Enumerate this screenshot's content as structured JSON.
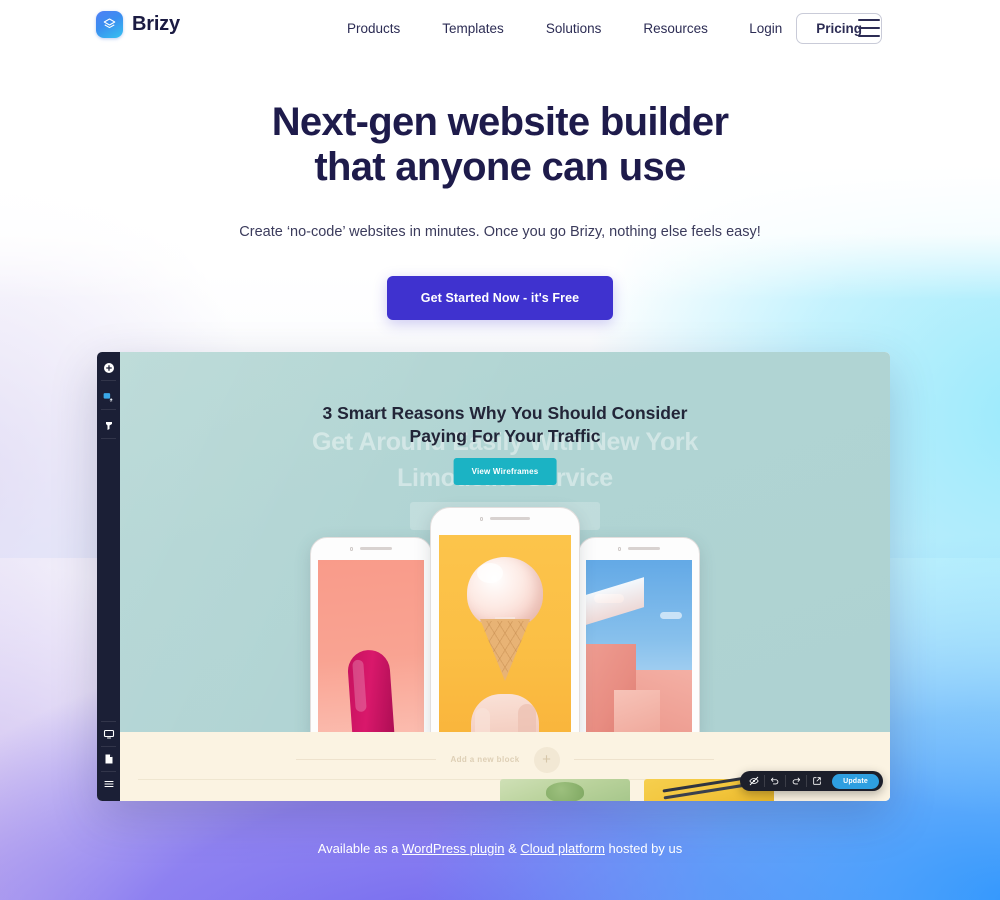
{
  "header": {
    "brand": {
      "name": "Brizy",
      "icon": "layers-icon"
    },
    "nav": [
      {
        "label": "Products"
      },
      {
        "label": "Templates"
      },
      {
        "label": "Solutions"
      },
      {
        "label": "Resources"
      }
    ],
    "login_label": "Login",
    "pricing_label": "Pricing",
    "menu_icon": "hamburger-menu-icon"
  },
  "hero": {
    "title_line1": "Next-gen website builder",
    "title_line2": "that anyone can use",
    "subtitle": "Create ‘no-code’ websites in minutes. Once you go Brizy, nothing else feels easy!",
    "cta_label": "Get Started Now - it's Free",
    "cta_color": "#3f32cf",
    "title_color": "#1e1b4b"
  },
  "editor": {
    "sidebar_tools": [
      {
        "name": "add-element-icon"
      },
      {
        "name": "styling-brush-icon"
      },
      {
        "name": "global-styles-icon"
      },
      {
        "name": "device-preview-icon"
      },
      {
        "name": "pages-icon"
      },
      {
        "name": "menu-icon"
      }
    ],
    "canvas": {
      "ghost_text_line1": "Get Around Easily With New York",
      "ghost_text_line2": "Limousine Service",
      "heading_line1": "3 Smart Reasons Why You Should Consider",
      "heading_line2": "Paying For Your Traffic",
      "button_label": "View Wireframes",
      "button_color": "#1bb3c4",
      "background_color": "#b0d4d3",
      "add_block_placeholder": "Add a new block",
      "add_block_icon": "plus-circle-icon",
      "cream_section_color": "#fbf3e2"
    },
    "toolbar": {
      "hide_icon": "eye-hidden-icon",
      "undo_icon": "undo-icon",
      "redo_icon": "redo-icon",
      "preview_icon": "external-link-icon",
      "update_label": "Update",
      "update_color": "#2e9fe0"
    }
  },
  "footer": {
    "prefix": "Available as a ",
    "link1": "WordPress plugin",
    "middle": " & ",
    "link2": "Cloud platform",
    "suffix": " hosted by us"
  }
}
